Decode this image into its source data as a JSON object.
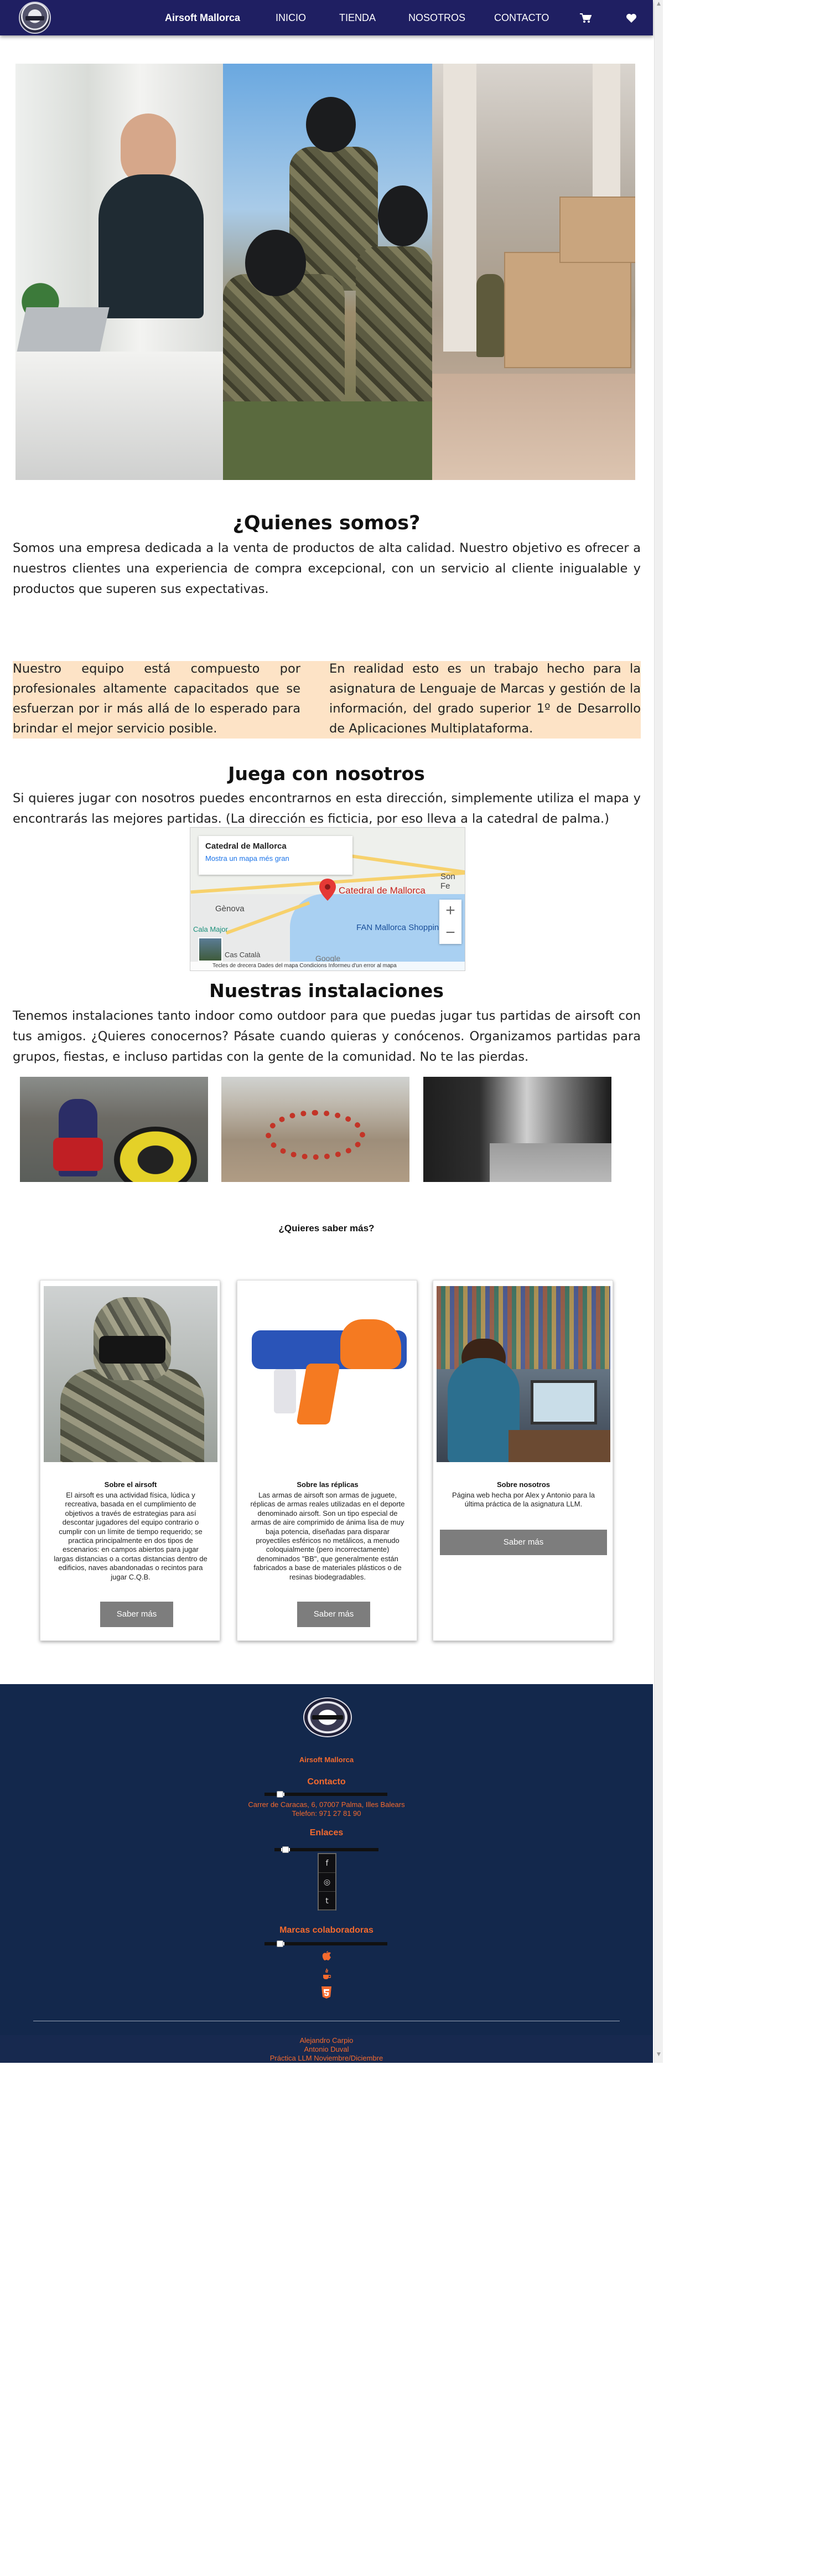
{
  "nav": {
    "brand": "Airsoft Mallorca",
    "items": [
      "INICIO",
      "TIENDA",
      "NOSOTROS",
      "CONTACTO"
    ],
    "cart_icon": "🛒",
    "heart_icon": "♥"
  },
  "about": {
    "title": "¿Quienes somos?",
    "text": "Somos una empresa dedicada a la venta de productos de alta calidad. Nuestro objetivo es ofrecer a nuestros clientes una experiencia de compra excepcional, con un servicio al cliente inigualable y productos que superen sus expectativas."
  },
  "band": {
    "left": "Nuestro equipo está compuesto por profesionales altamente capacitados que se esfuerzan por ir más allá de lo esperado para brindar el mejor servicio posible.",
    "right": "En realidad esto es un trabajo hecho para la asignatura de Lenguaje de Marcas y gestión de la información, del grado superior 1º de Desarrollo de Aplicaciones Multiplataforma.",
    "color": "#fde3c6"
  },
  "play": {
    "title": "Juega con nosotros",
    "text": "Si quieres jugar con nosotros puedes encontrarnos en esta dirección, simplemente utiliza el mapa y encontrarás las mejores partidas. (La dirección es ficticia, por eso lleva a la catedral de palma.)"
  },
  "map": {
    "place_title": "Catedral de Mallorca",
    "link": "Mostra un mapa més gran",
    "pin_label": "Catedral de Mallorca",
    "labels": [
      "Son Fe",
      "Gènova",
      "Cala Major",
      "FAN Mallorca Shoppin",
      "Cas Català"
    ],
    "footer": "Tecles de drecera   Dades del mapa   Condicions   Informeu d'un error al mapa",
    "google": "Google",
    "zoom_in": "+",
    "zoom_out": "−"
  },
  "facilities": {
    "title": "Nuestras instalaciones",
    "text": "Tenemos instalaciones tanto indoor como outdoor para que puedas jugar tus partidas de airsoft con tus amigos. ¿Quieres conocernos? Pásate cuando quieras y conócenos. Organizamos partidas para grupos, fiestas, e incluso partidas con la gente de la comunidad. No te las pierdas."
  },
  "more": {
    "title": "¿Quieres saber más?"
  },
  "cards": [
    {
      "title": "Sobre el airsoft",
      "text": "El airsoft es una actividad física, lúdica y recreativa, basada en el cumplimiento de objetivos a través de estrategias para así descontar jugadores del equipo contrario o cumplir con un límite de tiempo requerido; se practica principalmente en dos tipos de escenarios: en campos abiertos para jugar largas distancias o a cortas distancias dentro de edificios, naves abandonadas o recintos para jugar C.Q.B.",
      "button": "Saber más"
    },
    {
      "title": "Sobre las réplicas",
      "text": "Las armas de airsoft son armas de juguete, réplicas de armas reales utilizadas en el deporte denominado airsoft. Son un tipo especial de armas de aire comprimido de ánima lisa de muy baja potencia, diseñadas para disparar proyectiles esféricos no metálicos, a menudo coloquialmente (pero incorrectamente) denominados \"BB\", que generalmente están fabricados a base de materiales plásticos o de resinas biodegradables.",
      "button": "Saber más"
    },
    {
      "title": "Sobre nosotros",
      "text": "Página web hecha por Alex y Antonio para la última práctica de la asignatura LLM.",
      "button": "Saber más"
    }
  ],
  "footer": {
    "brand": "Airsoft Mallorca",
    "contact_title": "Contacto",
    "contact_lines": [
      "Carrer de Caracas, 6, 07007 Palma, Illes Balears",
      "Telefon: 971 27 81 90"
    ],
    "links_title": "Enlaces",
    "partners_title": "Marcas colaboradoras",
    "social": [
      "f",
      "◎",
      "t",
      "▶"
    ],
    "partner_icons": [
      "apple-icon",
      "java-icon",
      "html5-icon"
    ],
    "credits": [
      "Alejandro Carpio",
      "Antonio Duval",
      "Práctica LLM Noviembre/Diciembre"
    ],
    "accent": "#f46a2e",
    "bg": "#13284c"
  }
}
